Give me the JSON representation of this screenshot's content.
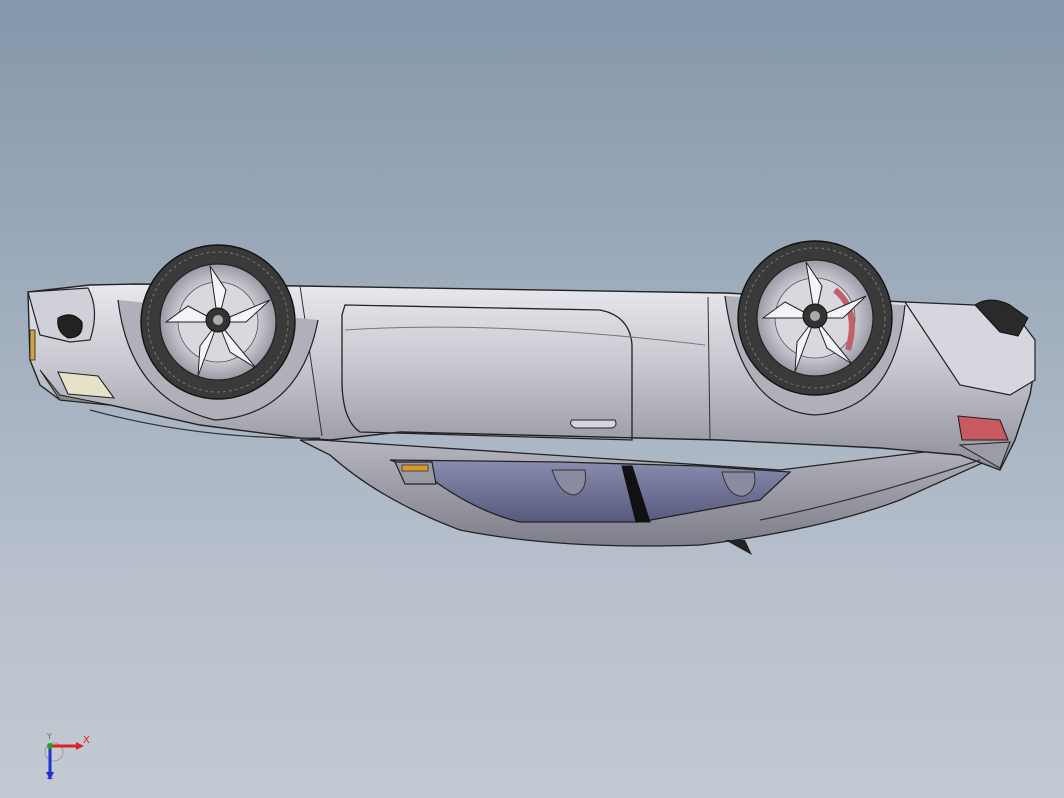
{
  "viewport": {
    "background_top": "#8597ab",
    "background_bottom": "#c3cad3"
  },
  "model": {
    "body_color": "#c4c4cc",
    "glass_color": "#6c6f92",
    "tire_color": "#3a3a3a"
  },
  "triad": {
    "x_label": "X",
    "y_label": "Y",
    "z_label": "Z",
    "x_color": "#e02020",
    "y_color": "#20a020",
    "z_color": "#2030d0"
  }
}
